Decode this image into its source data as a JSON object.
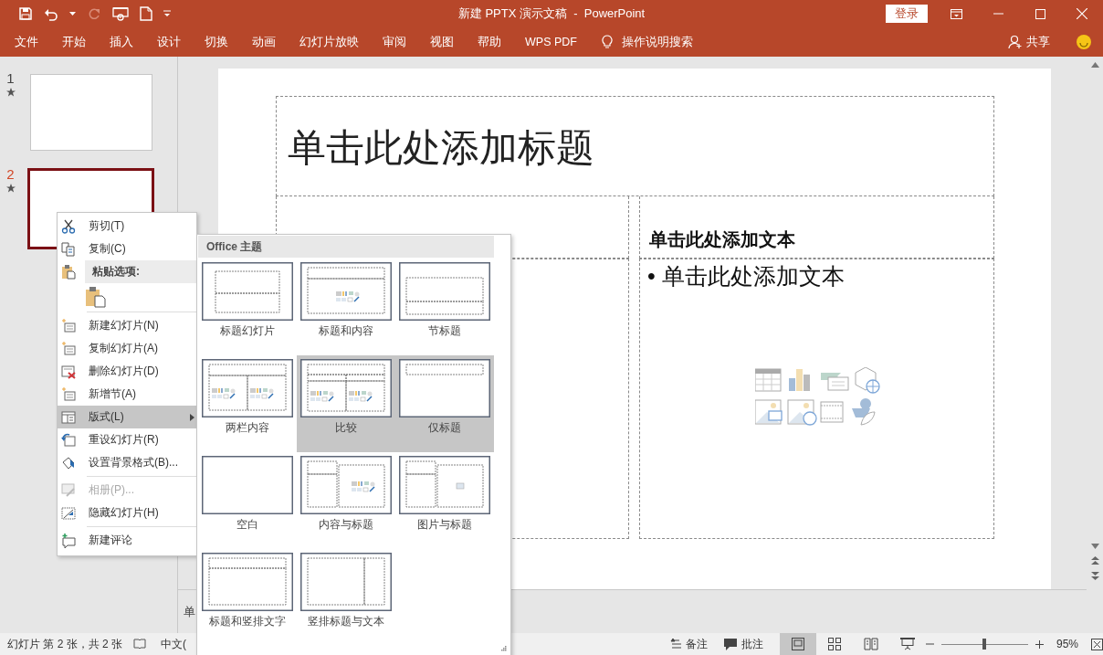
{
  "window": {
    "title": "新建 PPTX 演示文稿  -  PowerPoint",
    "login_button": "登录"
  },
  "ribbon": {
    "tabs": [
      "文件",
      "开始",
      "插入",
      "设计",
      "切换",
      "动画",
      "幻灯片放映",
      "审阅",
      "视图",
      "帮助",
      "WPS PDF"
    ],
    "tell_me": "操作说明搜索",
    "share": "共享"
  },
  "slides": [
    {
      "number": "1",
      "selected": false
    },
    {
      "number": "2",
      "selected": true
    }
  ],
  "slide": {
    "title_placeholder": "单击此处添加标题",
    "right_heading": "单击此处添加文本",
    "right_bullet": "• 单击此处添加文本"
  },
  "notes": {
    "placeholder": "单"
  },
  "context_menu": {
    "items": [
      {
        "kind": "item",
        "label": "剪切(T)",
        "disabled": false,
        "selected": false
      },
      {
        "kind": "item",
        "label": "复制(C)",
        "disabled": false,
        "selected": false
      },
      {
        "kind": "heading",
        "label": "粘贴选项:"
      },
      {
        "kind": "paste-options"
      },
      {
        "kind": "separator"
      },
      {
        "kind": "item",
        "label": "新建幻灯片(N)",
        "disabled": false,
        "selected": false
      },
      {
        "kind": "item",
        "label": "复制幻灯片(A)",
        "disabled": false,
        "selected": false
      },
      {
        "kind": "item",
        "label": "删除幻灯片(D)",
        "disabled": false,
        "selected": false
      },
      {
        "kind": "item",
        "label": "新增节(A)",
        "disabled": false,
        "selected": false
      },
      {
        "kind": "submenu",
        "label": "版式(L)",
        "disabled": false,
        "selected": true
      },
      {
        "kind": "item",
        "label": "重设幻灯片(R)",
        "disabled": false,
        "selected": false
      },
      {
        "kind": "item",
        "label": "设置背景格式(B)...",
        "disabled": false,
        "selected": false
      },
      {
        "kind": "separator"
      },
      {
        "kind": "item",
        "label": "相册(P)...",
        "disabled": true,
        "selected": false
      },
      {
        "kind": "item",
        "label": "隐藏幻灯片(H)",
        "disabled": false,
        "selected": false
      },
      {
        "kind": "separator"
      },
      {
        "kind": "item",
        "label": "新建评论",
        "disabled": false,
        "selected": false
      }
    ]
  },
  "layout_gallery": {
    "heading": "Office 主题",
    "layouts": [
      {
        "kind": "title",
        "label": "标题幻灯片",
        "selected": false
      },
      {
        "kind": "title-content",
        "label": "标题和内容",
        "selected": false
      },
      {
        "kind": "section",
        "label": "节标题",
        "selected": false
      },
      {
        "kind": "two-content",
        "label": "两栏内容",
        "selected": false
      },
      {
        "kind": "comparison",
        "label": "比较",
        "selected": true
      },
      {
        "kind": "title-only",
        "label": "仅标题",
        "selected": true
      },
      {
        "kind": "blank",
        "label": "空白",
        "selected": false
      },
      {
        "kind": "content-caption",
        "label": "内容与标题",
        "selected": false
      },
      {
        "kind": "picture-caption",
        "label": "图片与标题",
        "selected": false
      },
      {
        "kind": "title-vertical",
        "label": "标题和竖排文字",
        "selected": false
      },
      {
        "kind": "vertical-title",
        "label": "竖排标题与文本",
        "selected": false
      }
    ]
  },
  "status_bar": {
    "slide_info": "幻灯片 第 2 张，共 2 张",
    "language": "中文(",
    "notes_button": "备注",
    "comments_button": "批注",
    "views": [
      {
        "kind": "normal",
        "selected": true
      },
      {
        "kind": "sorter",
        "selected": false
      },
      {
        "kind": "reading",
        "selected": false
      },
      {
        "kind": "slideshow",
        "selected": false
      }
    ],
    "zoom": {
      "level": 0.5,
      "reading": "95%"
    }
  }
}
